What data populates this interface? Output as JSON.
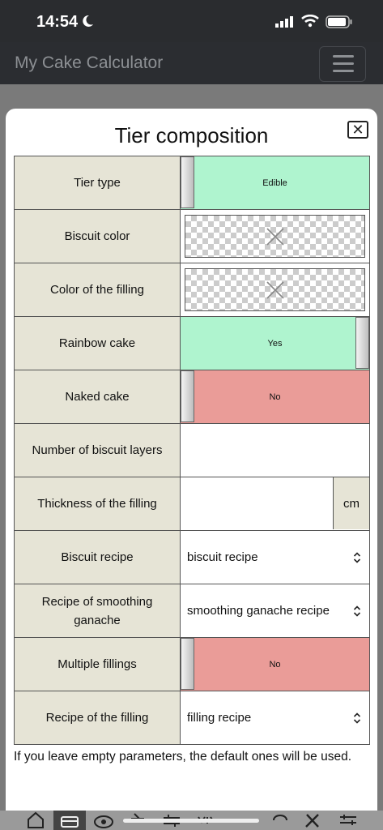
{
  "status_bar": {
    "time": "14:54"
  },
  "app": {
    "title": "My Cake Calculator"
  },
  "modal": {
    "title": "Tier composition",
    "close_label": "✕",
    "rows": [
      {
        "label": "Tier type",
        "type": "toggle",
        "value": "Edible",
        "state": "green",
        "knob": "left"
      },
      {
        "label": "Biscuit color",
        "type": "color"
      },
      {
        "label": "Color of the filling",
        "type": "color"
      },
      {
        "label": "Rainbow cake",
        "type": "toggle",
        "value": "Yes",
        "state": "green",
        "knob": "right"
      },
      {
        "label": "Naked cake",
        "type": "toggle",
        "value": "No",
        "state": "red",
        "knob": "left"
      },
      {
        "label": "Number of biscuit layers",
        "type": "input",
        "value": ""
      },
      {
        "label": "Thickness of the filling",
        "type": "input-unit",
        "value": "",
        "unit": "cm"
      },
      {
        "label": "Biscuit recipe",
        "type": "select",
        "value": "biscuit recipe"
      },
      {
        "label": "Recipe of smoothing ganache",
        "type": "select",
        "value": "smoothing ganache recipe"
      },
      {
        "label": "Multiple fillings",
        "type": "toggle",
        "value": "No",
        "state": "red",
        "knob": "left"
      },
      {
        "label": "Recipe of the filling",
        "type": "select",
        "value": "filling recipe"
      }
    ],
    "note": "If you leave empty parameters, the default ones will be used."
  },
  "tab_bar": {
    "icons": [
      "home-icon",
      "card-icon",
      "eye-icon",
      "cake-icon",
      "sliders-icon",
      "ruler-icon",
      "chef-hat-icon",
      "tools-icon",
      "settings-icon"
    ],
    "active": 1
  }
}
